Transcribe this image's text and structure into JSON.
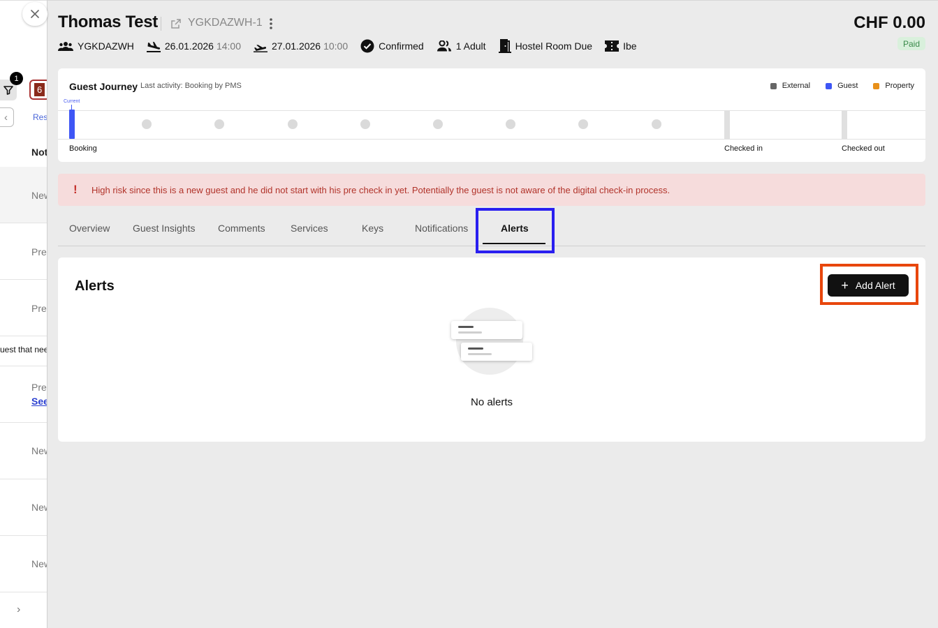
{
  "background_list": {
    "filter_badge": "1",
    "count_badge": "6",
    "res_link": "Res",
    "column_header": "Not",
    "rows": [
      "New",
      "Pre",
      "Pre",
      "Pre",
      "New",
      "New",
      "New"
    ],
    "snippet": "uest that nee",
    "see_link": "See"
  },
  "header": {
    "guest_name": "Thomas Test",
    "reservation_code": "YGKDAZWH-1",
    "total": "CHF 0.00",
    "payment_status": "Paid",
    "meta": {
      "group": "YGKDAZWH",
      "arrival_date": "26.01.2026",
      "arrival_time": "14:00",
      "departure_date": "27.01.2026",
      "departure_time": "10:00",
      "status": "Confirmed",
      "guests": "1 Adult",
      "room": "Hostel Room Due",
      "channel": "Ibe"
    }
  },
  "journey": {
    "title": "Guest Journey",
    "last_activity": "Last activity: Booking by PMS",
    "current_label": "Current",
    "legend": [
      {
        "label": "External",
        "color": "#666666"
      },
      {
        "label": "Guest",
        "color": "#3e56f5"
      },
      {
        "label": "Property",
        "color": "#e8901a"
      }
    ],
    "stages": [
      "Booking",
      "Checked in",
      "Checked out"
    ]
  },
  "risk_banner": {
    "text": "High risk since this is a new guest and he did not start with his pre check in yet. Potentially the guest is not aware of the digital check-in process."
  },
  "tabs": [
    "Overview",
    "Guest Insights",
    "Comments",
    "Services",
    "Keys",
    "Notifications",
    "Alerts"
  ],
  "alerts": {
    "title": "Alerts",
    "add_button": "Add Alert",
    "empty_text": "No alerts"
  }
}
